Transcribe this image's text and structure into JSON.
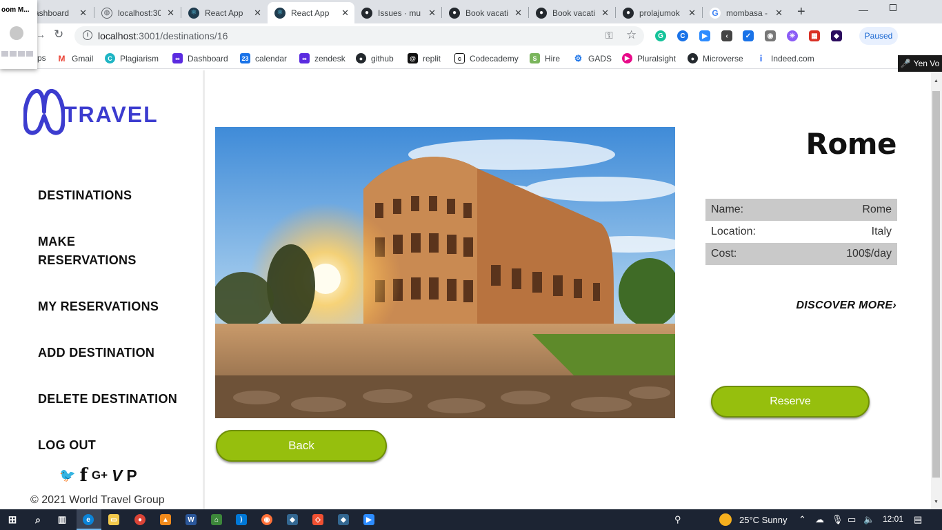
{
  "browser": {
    "tabs": [
      {
        "label": "ashboard",
        "icon": "dashboard-tab-icon"
      },
      {
        "label": "localhost:30",
        "icon": "globe-icon"
      },
      {
        "label": "React App",
        "icon": "react-icon"
      },
      {
        "label": "React App",
        "icon": "react-icon",
        "active": true
      },
      {
        "label": "Issues · mu",
        "icon": "github-icon"
      },
      {
        "label": "Book vacati",
        "icon": "github-icon"
      },
      {
        "label": "Book vacati",
        "icon": "github-icon"
      },
      {
        "label": "prolajumok",
        "icon": "github-icon"
      },
      {
        "label": "mombasa -",
        "icon": "google-icon"
      }
    ],
    "zoom_window_title": "oom M...",
    "zoom_user": "Yen Vo",
    "url_host": "localhost",
    "url_rest": ":3001/destinations/16",
    "paused_label": "Paused",
    "bookmarks": [
      {
        "label": "ps"
      },
      {
        "label": "Gmail"
      },
      {
        "label": "Plagiarism"
      },
      {
        "label": "Dashboard"
      },
      {
        "label": "calendar"
      },
      {
        "label": "zendesk"
      },
      {
        "label": "github"
      },
      {
        "label": "replit"
      },
      {
        "label": "Codecademy"
      },
      {
        "label": "Hire"
      },
      {
        "label": "GADS"
      },
      {
        "label": "Pluralsight"
      },
      {
        "label": "Microverse"
      },
      {
        "label": "Indeed.com"
      }
    ]
  },
  "sidebar": {
    "logo_text": "TRAVEL",
    "nav": [
      "DESTINATIONS",
      "MAKE RESERVATIONS",
      "MY RESERVATIONS",
      "ADD DESTINATION",
      "DELETE DESTINATION",
      "LOG OUT"
    ],
    "social_icons": [
      "twitter-icon",
      "facebook-icon",
      "google-plus-icon",
      "vimeo-icon",
      "pinterest-icon"
    ],
    "social_glyphs": {
      "twitter": "🐦",
      "facebook": "f",
      "google_plus": "G+",
      "vimeo": "V",
      "pinterest": "P"
    },
    "copyright": "© 2021 World Travel Group"
  },
  "destination": {
    "title": "Rome",
    "details": [
      {
        "label": "Name:",
        "value": "Rome"
      },
      {
        "label": "Location:",
        "value": "Italy"
      },
      {
        "label": "Cost:",
        "value": "100$/day"
      }
    ],
    "discover_label": "DISCOVER MORE",
    "reserve_label": "Reserve",
    "back_label": "Back"
  },
  "taskbar": {
    "weather": "25°C  Sunny",
    "time": "12:01"
  },
  "colors": {
    "accent_green": "#96bf0d",
    "logo_blue": "#3c3ccf",
    "detail_row_shade": "#c9c9c9"
  }
}
